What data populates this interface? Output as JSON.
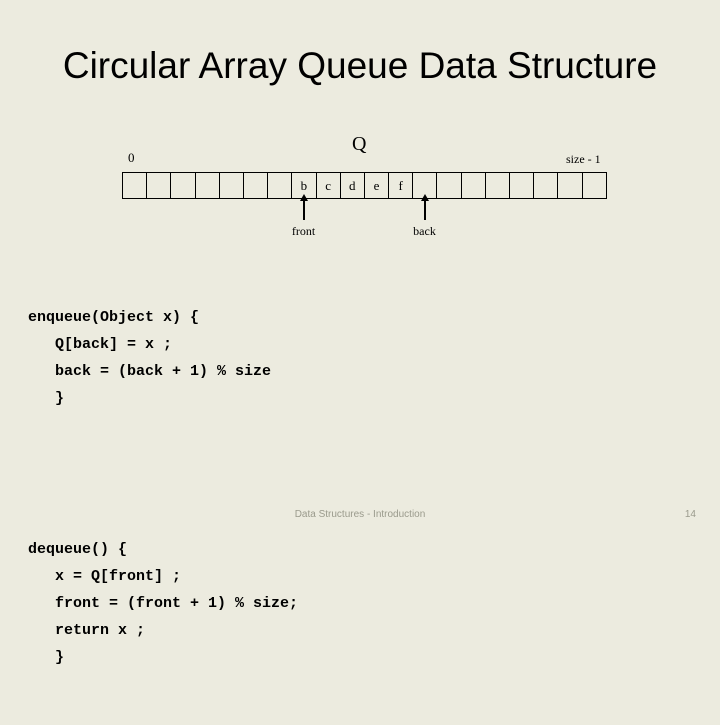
{
  "slide": {
    "title": "Circular Array Queue Data Structure",
    "background_color": "#ecebdf",
    "text_color": "#000000"
  },
  "diagram": {
    "array_name": "Q",
    "index_start_label": "0",
    "index_end_label": "size - 1",
    "cell_count": 20,
    "cells": [
      "",
      "",
      "",
      "",
      "",
      "",
      "",
      "b",
      "c",
      "d",
      "e",
      "f",
      "",
      "",
      "",
      "",
      "",
      "",
      "",
      ""
    ],
    "pointers": [
      {
        "label": "front",
        "cell_index": 7
      },
      {
        "label": "back",
        "cell_index": 12
      }
    ]
  },
  "code": {
    "enqueue": [
      "enqueue(Object x) {",
      "   Q[back] = x ;",
      "   back = (back + 1) % size",
      "   }"
    ],
    "dequeue": [
      "dequeue() {",
      "   x = Q[front] ;",
      "   front = (front + 1) % size;",
      "   return x ;",
      "   }"
    ]
  },
  "footer": {
    "text": "Data Structures - Introduction",
    "page_number": "14",
    "color": "#9a9a8c"
  }
}
